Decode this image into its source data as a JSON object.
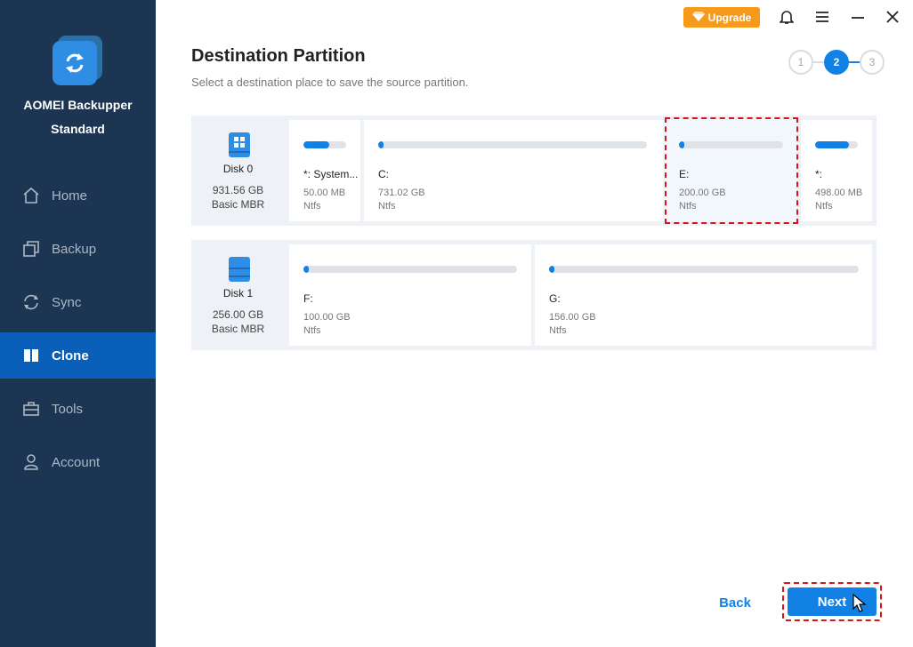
{
  "app": {
    "name_line1": "AOMEI Backupper",
    "name_line2": "Standard"
  },
  "titlebar": {
    "upgrade_label": "Upgrade"
  },
  "sidebar": {
    "items": [
      {
        "label": "Home",
        "icon": "home-icon"
      },
      {
        "label": "Backup",
        "icon": "backup-icon"
      },
      {
        "label": "Sync",
        "icon": "sync-icon"
      },
      {
        "label": "Clone",
        "icon": "clone-icon",
        "active": true
      },
      {
        "label": "Tools",
        "icon": "tools-icon"
      },
      {
        "label": "Account",
        "icon": "account-icon"
      }
    ]
  },
  "header": {
    "title": "Destination Partition",
    "subtitle": "Select a destination place to save the source partition."
  },
  "steps": {
    "items": [
      "1",
      "2",
      "3"
    ],
    "active": "2"
  },
  "disks": [
    {
      "name": "Disk 0",
      "size": "931.56 GB",
      "type": "Basic MBR",
      "partitions": [
        {
          "label": "*: System...",
          "size": "50.00 MB",
          "fs": "Ntfs",
          "used_fraction": 0.6
        },
        {
          "label": "C:",
          "size": "731.02 GB",
          "fs": "Ntfs",
          "used_fraction": 0.02
        },
        {
          "label": "E:",
          "size": "200.00 GB",
          "fs": "Ntfs",
          "used_fraction": 0.03,
          "selected": true
        },
        {
          "label": "*:",
          "size": "498.00 MB",
          "fs": "Ntfs",
          "used_fraction": 0.8
        }
      ]
    },
    {
      "name": "Disk 1",
      "size": "256.00 GB",
      "type": "Basic MBR",
      "partitions": [
        {
          "label": "F:",
          "size": "100.00 GB",
          "fs": "Ntfs",
          "used_fraction": 0.02
        },
        {
          "label": "G:",
          "size": "156.00 GB",
          "fs": "Ntfs",
          "used_fraction": 0.01
        }
      ]
    }
  ],
  "footer": {
    "back_label": "Back",
    "next_label": "Next"
  },
  "colors": {
    "sidebar": "#1b3552",
    "accent": "#1281e6",
    "upgrade": "#f59a1a",
    "highlight": "#d8141b"
  }
}
